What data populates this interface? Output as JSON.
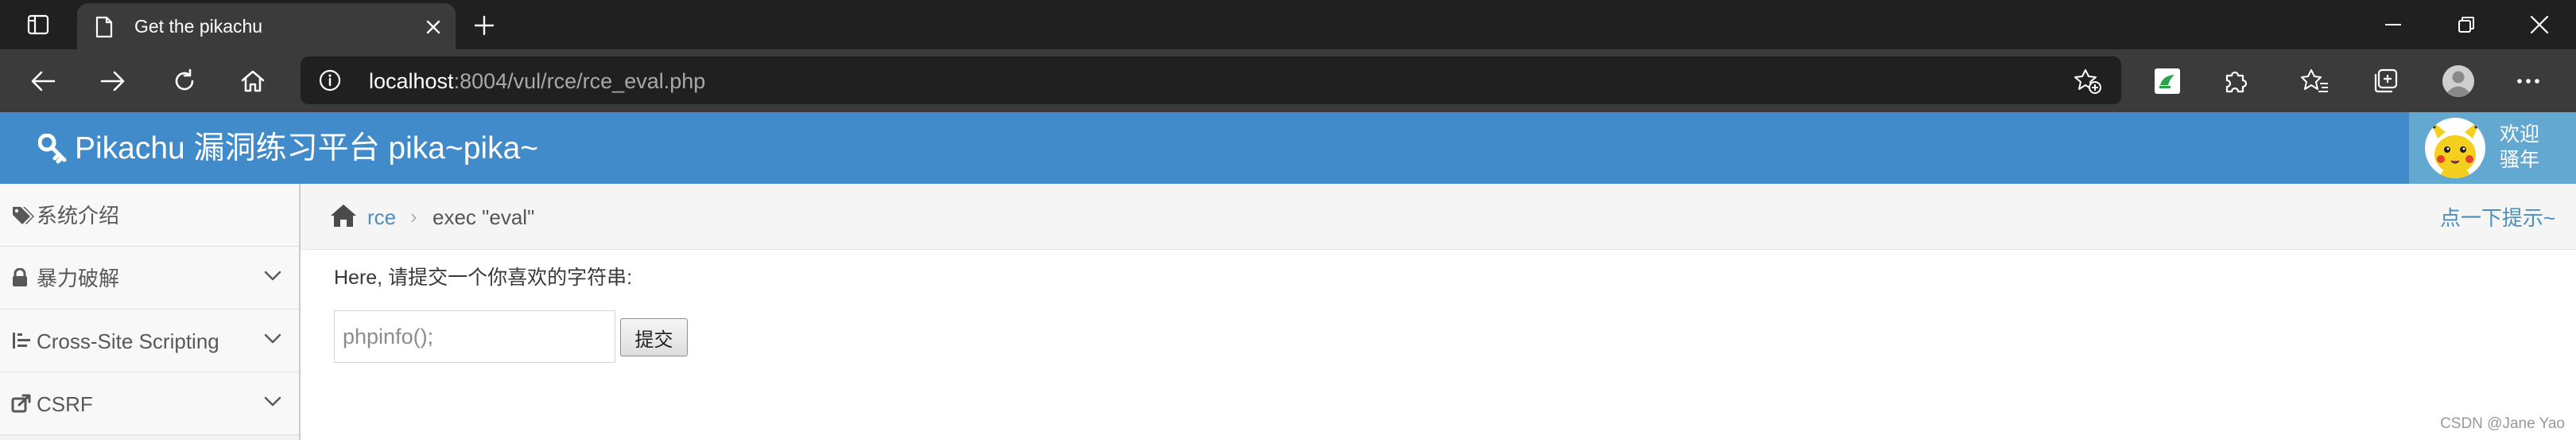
{
  "browser": {
    "tab_title": "Get the pikachu",
    "url_host": "localhost",
    "url_rest": ":8004/vul/rce/rce_eval.php"
  },
  "header": {
    "title": "Pikachu 漏洞练习平台 pika~pika~",
    "welcome_line1": "欢迎",
    "welcome_line2": "骚年"
  },
  "sidebar": {
    "items": [
      {
        "label": "系统介绍"
      },
      {
        "label": "暴力破解"
      },
      {
        "label": "Cross-Site Scripting"
      },
      {
        "label": "CSRF"
      }
    ]
  },
  "breadcrumb": {
    "link": "rce",
    "separator": "›",
    "current": "exec \"eval\""
  },
  "hint_link": "点一下提示~",
  "form": {
    "prompt": "Here, 请提交一个你喜欢的字符串:",
    "placeholder": "phpinfo();",
    "submit_label": "提交"
  },
  "watermark": "CSDN @Jane Yao",
  "colors": {
    "header_bg": "#428bca",
    "link": "#4c8fbd",
    "browser_dark": "#202020",
    "browser_toolbar": "#3b3b3b"
  },
  "icons": {
    "tab_actions": "tab-actions-icon",
    "favicon": "page-icon",
    "back": "back-arrow-icon",
    "forward": "forward-arrow-icon",
    "reload": "reload-icon",
    "home": "home-icon",
    "site_info": "info-icon",
    "add_favorite": "star-plus-icon",
    "brand": "wrench-icon",
    "sidebar_intro": "tags-icon",
    "sidebar_brute": "lock-icon",
    "sidebar_xss": "indent-icon",
    "sidebar_csrf": "share-icon"
  }
}
